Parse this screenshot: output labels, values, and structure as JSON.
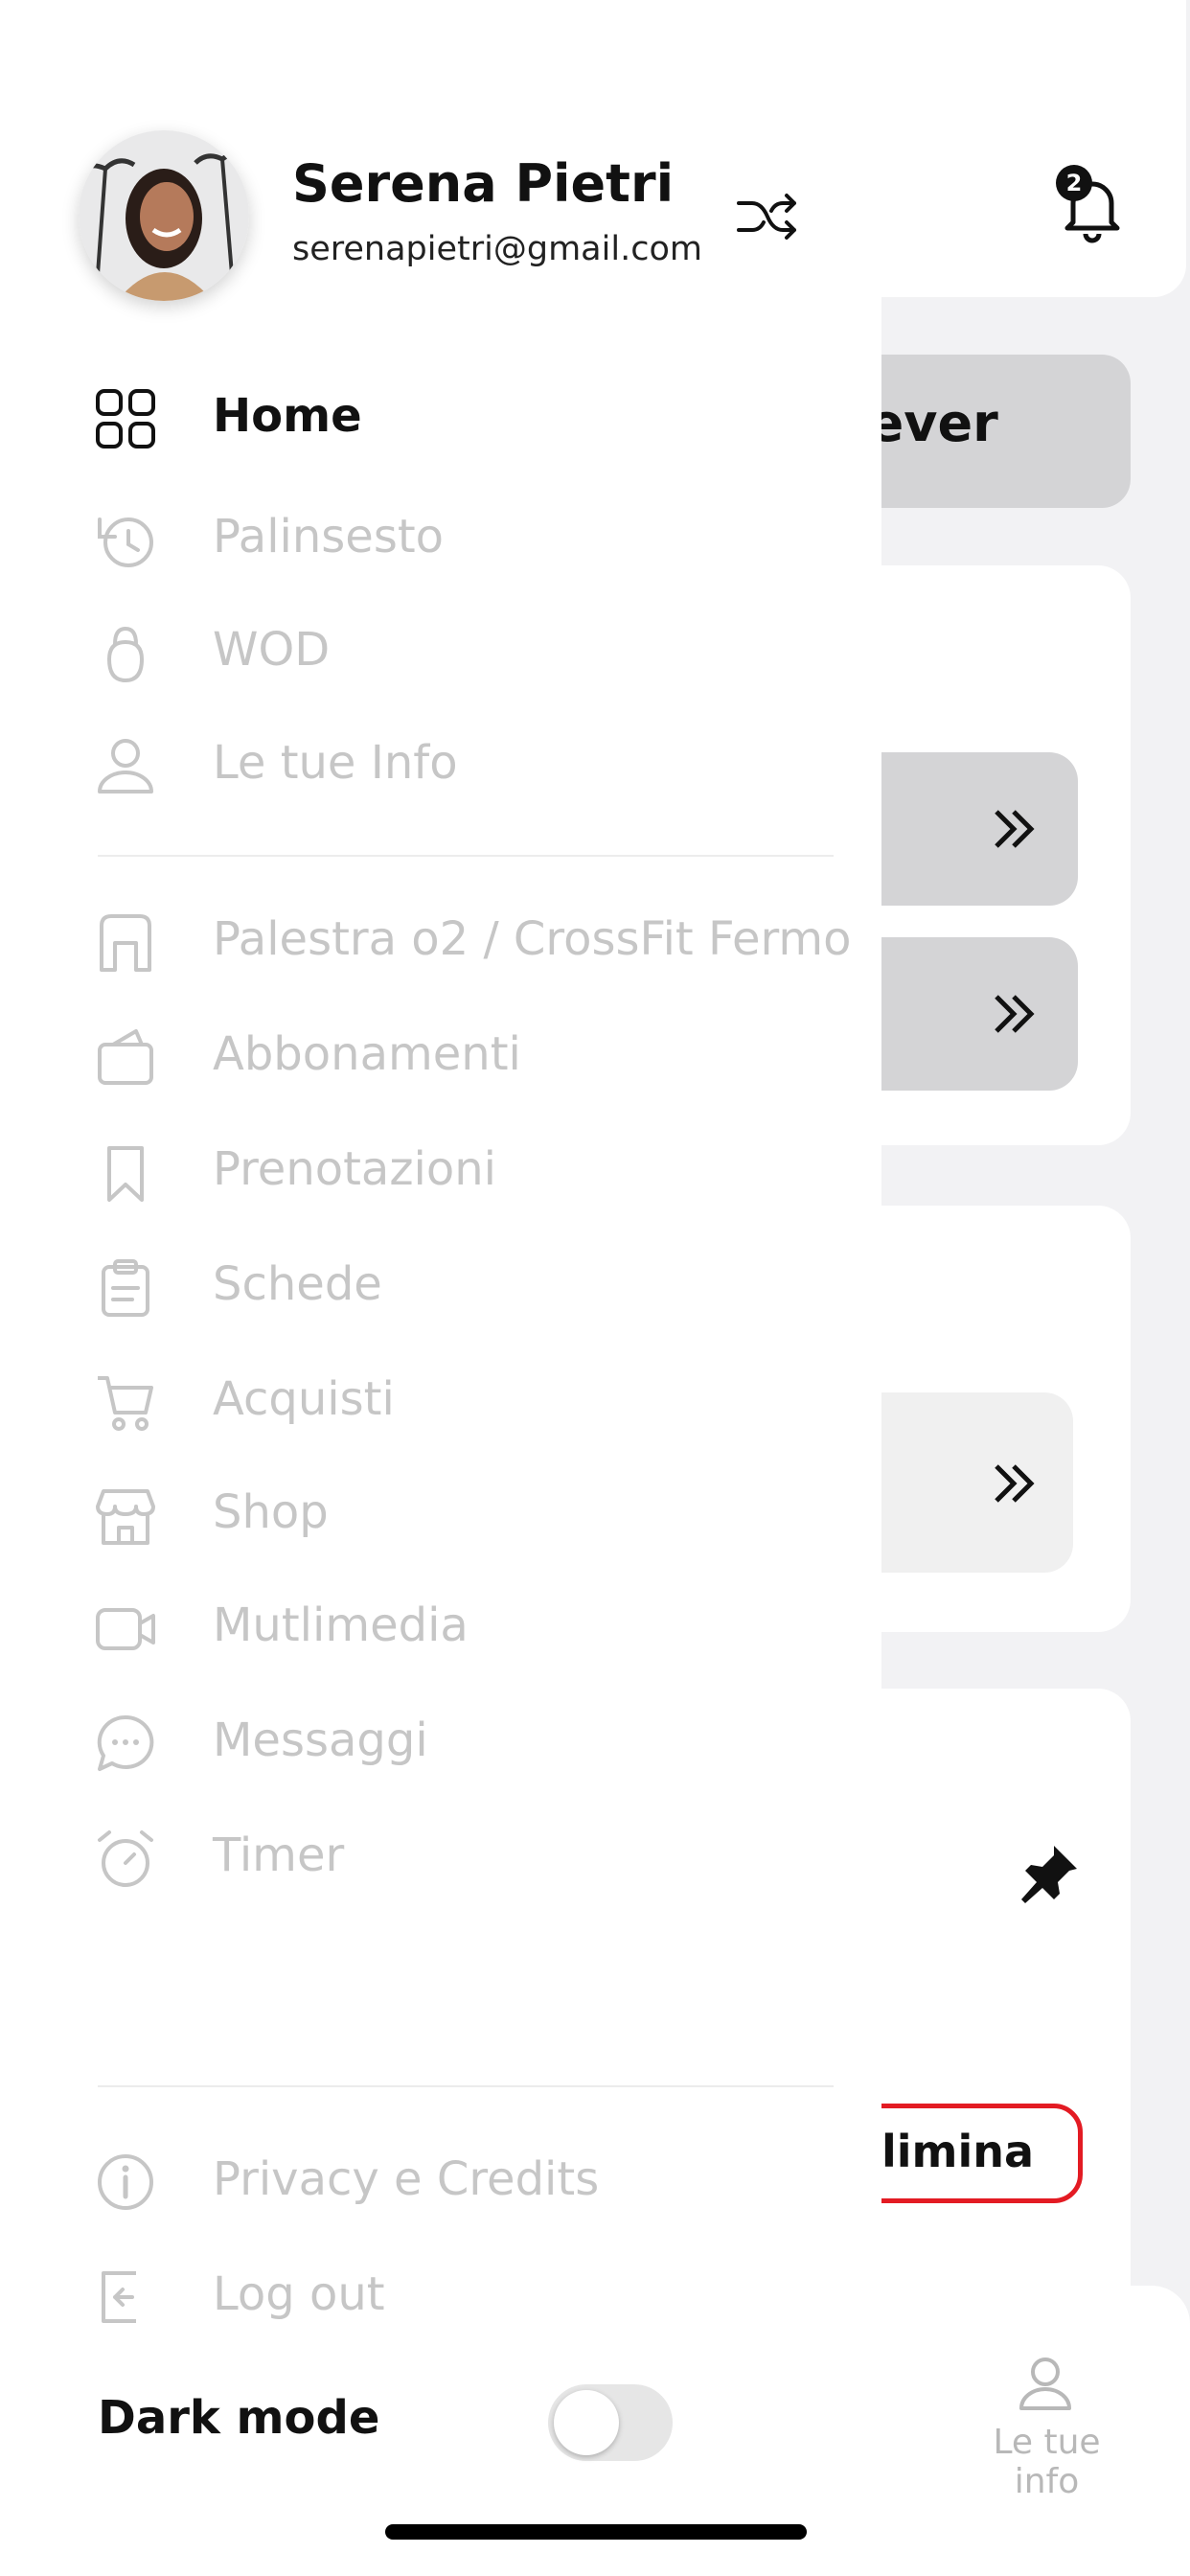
{
  "background": {
    "notifications_count": "2",
    "forever_fragment": "rever",
    "elimina_fragment": "limina",
    "tabbar": {
      "user_tab_label": "Le tue info"
    }
  },
  "drawer": {
    "user": {
      "name": "Serena Pietri",
      "email": "serenapietri@gmail.com"
    },
    "menu_primary": [
      {
        "label": "Home",
        "icon": "grid-icon",
        "active": true
      },
      {
        "label": "Palinsesto",
        "icon": "history-icon"
      },
      {
        "label": "WOD",
        "icon": "kettlebell-icon"
      },
      {
        "label": "Le tue Info",
        "icon": "user-icon"
      }
    ],
    "menu_secondary": [
      {
        "label": "Palestra o2 / CrossFit Fermo",
        "icon": "gym-icon"
      },
      {
        "label": "Abbonamenti",
        "icon": "wallet-icon"
      },
      {
        "label": "Prenotazioni",
        "icon": "bookmark-icon"
      },
      {
        "label": "Schede",
        "icon": "clipboard-icon"
      },
      {
        "label": "Acquisti",
        "icon": "cart-icon"
      },
      {
        "label": "Shop",
        "icon": "shop-icon"
      },
      {
        "label": "Mutlimedia",
        "icon": "video-icon"
      },
      {
        "label": "Messaggi",
        "icon": "chat-icon"
      },
      {
        "label": "Timer",
        "icon": "timer-icon"
      }
    ],
    "menu_footer": [
      {
        "label": "Privacy e Credits",
        "icon": "info-icon"
      },
      {
        "label": "Log out",
        "icon": "logout-icon"
      }
    ],
    "dark_mode": {
      "label": "Dark mode",
      "enabled": false
    }
  },
  "colors": {
    "active_text": "#111111",
    "inactive_text": "#c6c6c6",
    "danger": "#e31b23",
    "pill_gray": "#d4d4d6"
  }
}
